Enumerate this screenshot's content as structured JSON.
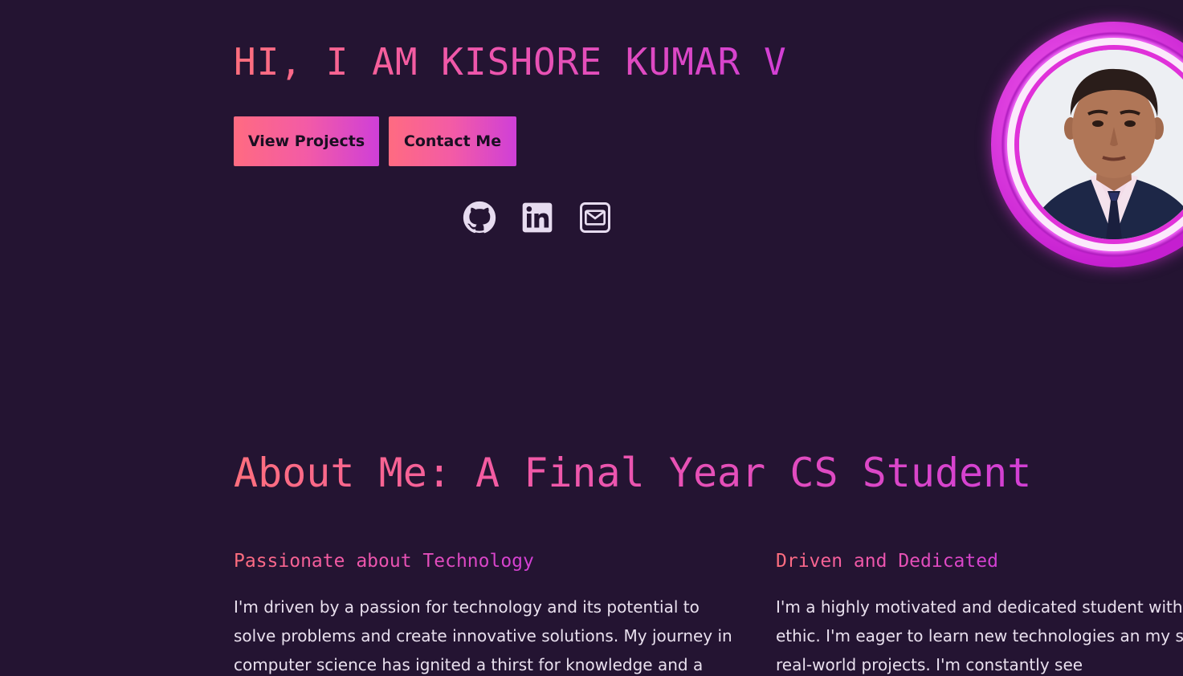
{
  "hero": {
    "title": "HI, I AM KISHORE KUMAR V",
    "buttons": {
      "projects": "View Projects",
      "contact": "Contact Me"
    },
    "socials": [
      {
        "icon": "github-icon"
      },
      {
        "icon": "linkedin-icon"
      },
      {
        "icon": "mail-icon"
      }
    ]
  },
  "about": {
    "title": "About Me: A Final Year CS Student",
    "columns": [
      {
        "heading": "Passionate about Technology",
        "text": "I'm driven by a passion for technology and its potential to solve problems and create innovative solutions. My journey in computer science has ignited a thirst for knowledge and a"
      },
      {
        "heading": "Driven and Dedicated",
        "text": "I'm a highly motivated and dedicated student with work ethic. I'm eager to learn new technologies an my skills to real-world projects. I'm constantly see"
      }
    ]
  },
  "colors": {
    "background": "#241432",
    "gradient_start": "#ff6f7d",
    "gradient_end": "#d23fd5",
    "text": "#e9e0ee"
  }
}
